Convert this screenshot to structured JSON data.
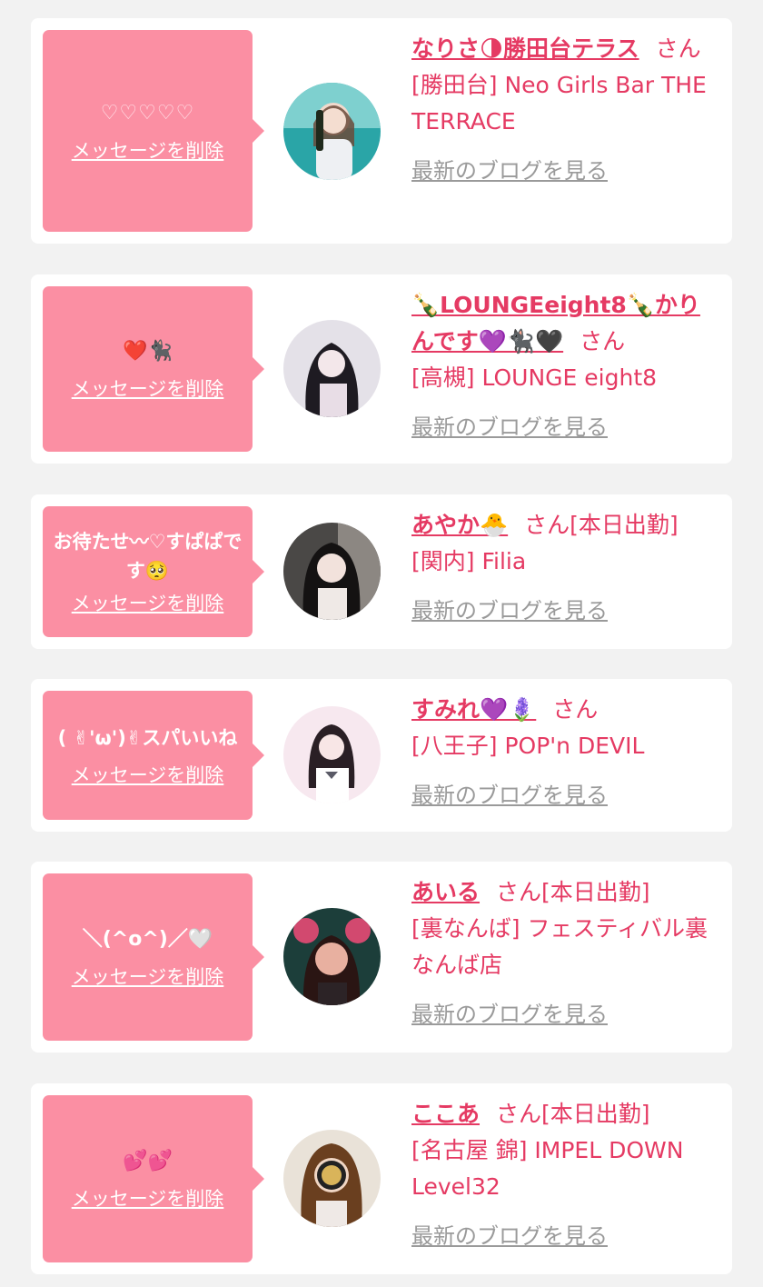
{
  "cards": [
    {
      "message": "♡♡♡♡♡",
      "delete_label": "メッセージを削除",
      "name": "なりさ🌗勝田台テラス",
      "honorific": "さん",
      "status": "",
      "shop": "[勝田台] Neo Girls Bar THE TERRACE",
      "blog_label": "最新のブログを見る",
      "avatar_colors": [
        "#2aa5a7",
        "#7ed0cf"
      ]
    },
    {
      "message": "❤️🐈‍⬛",
      "delete_label": "メッセージを削除",
      "name": "🍾LOUNGEeight8🍾かりんです💜🐈‍⬛🖤",
      "honorific": "さん",
      "status": "",
      "shop": "[高槻] LOUNGE eight8",
      "blog_label": "最新のブログを見る",
      "avatar_colors": [
        "#d9d6de",
        "#f3eef3"
      ]
    },
    {
      "message": "お待たせ〰♡すぱぱです🥺",
      "delete_label": "メッセージを削除",
      "name": "あやか🐣",
      "honorific": "さん",
      "status": "[本日出勤]",
      "shop": "[関内] Filia",
      "blog_label": "最新のブログを見る",
      "avatar_colors": [
        "#3b3a3a",
        "#cfcac4"
      ]
    },
    {
      "message": "( ✌︎'ω')✌︎スパいいね",
      "delete_label": "メッセージを削除",
      "name": "すみれ💜🪻",
      "honorific": "さん",
      "status": "",
      "shop": "[八王子] POP'n DEVIL",
      "blog_label": "最新のブログを見る",
      "avatar_colors": [
        "#f7e7ee",
        "#f0d2de"
      ]
    },
    {
      "message": "＼(^o^)／🤍",
      "delete_label": "メッセージを削除",
      "name": "あいる",
      "honorific": "さん",
      "status": "[本日出勤]",
      "shop": "[裏なんば] フェスティバル裏なんば店",
      "blog_label": "最新のブログを見る",
      "avatar_colors": [
        "#1a4a44",
        "#d2496f"
      ]
    },
    {
      "message": "💕💕",
      "delete_label": "メッセージを削除",
      "name": "ここあ",
      "honorific": "さん",
      "status": "[本日出勤]",
      "shop": "[名古屋 錦] IMPEL DOWN Level32",
      "blog_label": "最新のブログを見る",
      "avatar_colors": [
        "#7a4a2a",
        "#d8b48a"
      ]
    }
  ]
}
